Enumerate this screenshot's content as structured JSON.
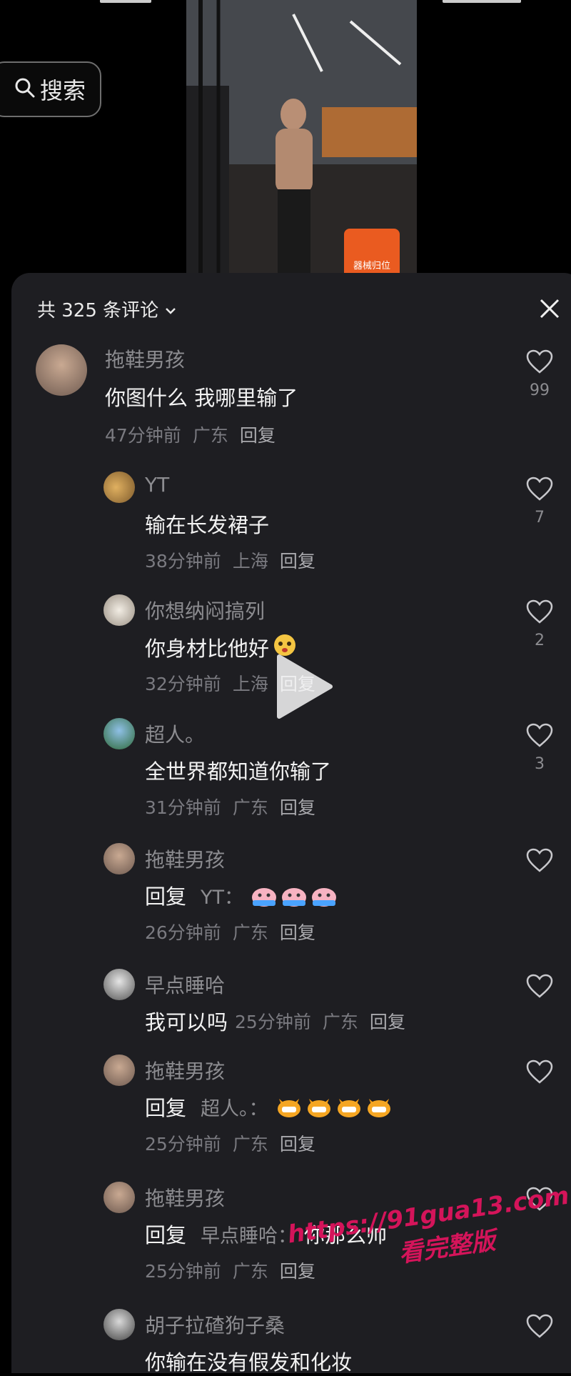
{
  "top": {
    "search_label": "搜索"
  },
  "video": {
    "badge_text": "器械归位"
  },
  "panel": {
    "title": "共 325 条评论",
    "accent": "#1e1e22"
  },
  "comments": [
    {
      "author": "拖鞋男孩",
      "text": "你图什么 我哪里输了",
      "time": "47分钟前",
      "region": "广东",
      "reply": "回复",
      "likes": "99"
    },
    {
      "author": "YT",
      "text": "输在长发裙子",
      "time": "38分钟前",
      "region": "上海",
      "reply": "回复",
      "likes": "7"
    },
    {
      "author": "你想纳闷搞列",
      "text": "你身材比他好",
      "time": "32分钟前",
      "region": "上海",
      "reply": "回复",
      "likes": "2"
    },
    {
      "author": "超人。",
      "text": "全世界都知道你输了",
      "time": "31分钟前",
      "region": "广东",
      "reply": "回复",
      "likes": "3"
    },
    {
      "author": "拖鞋男孩",
      "text_prefix": "回复",
      "reply_to": "YT：",
      "time": "26分钟前",
      "region": "广东",
      "reply": "回复"
    },
    {
      "author": "早点睡哈",
      "text": "我可以吗",
      "time": "25分钟前",
      "region": "广东",
      "reply": "回复"
    },
    {
      "author": "拖鞋男孩",
      "text_prefix": "回复",
      "reply_to": "超人。：",
      "time": "25分钟前",
      "region": "广东",
      "reply": "回复"
    },
    {
      "author": "拖鞋男孩",
      "text_prefix": "回复",
      "reply_to": "早点睡哈：",
      "text": "你那么帅",
      "time": "25分钟前",
      "region": "广东",
      "reply": "回复"
    },
    {
      "author": "胡子拉碴狗子桑",
      "text": "你输在没有假发和化妆"
    }
  ],
  "watermark": {
    "line1": "https://91gua13.com",
    "line2": "看完整版"
  }
}
